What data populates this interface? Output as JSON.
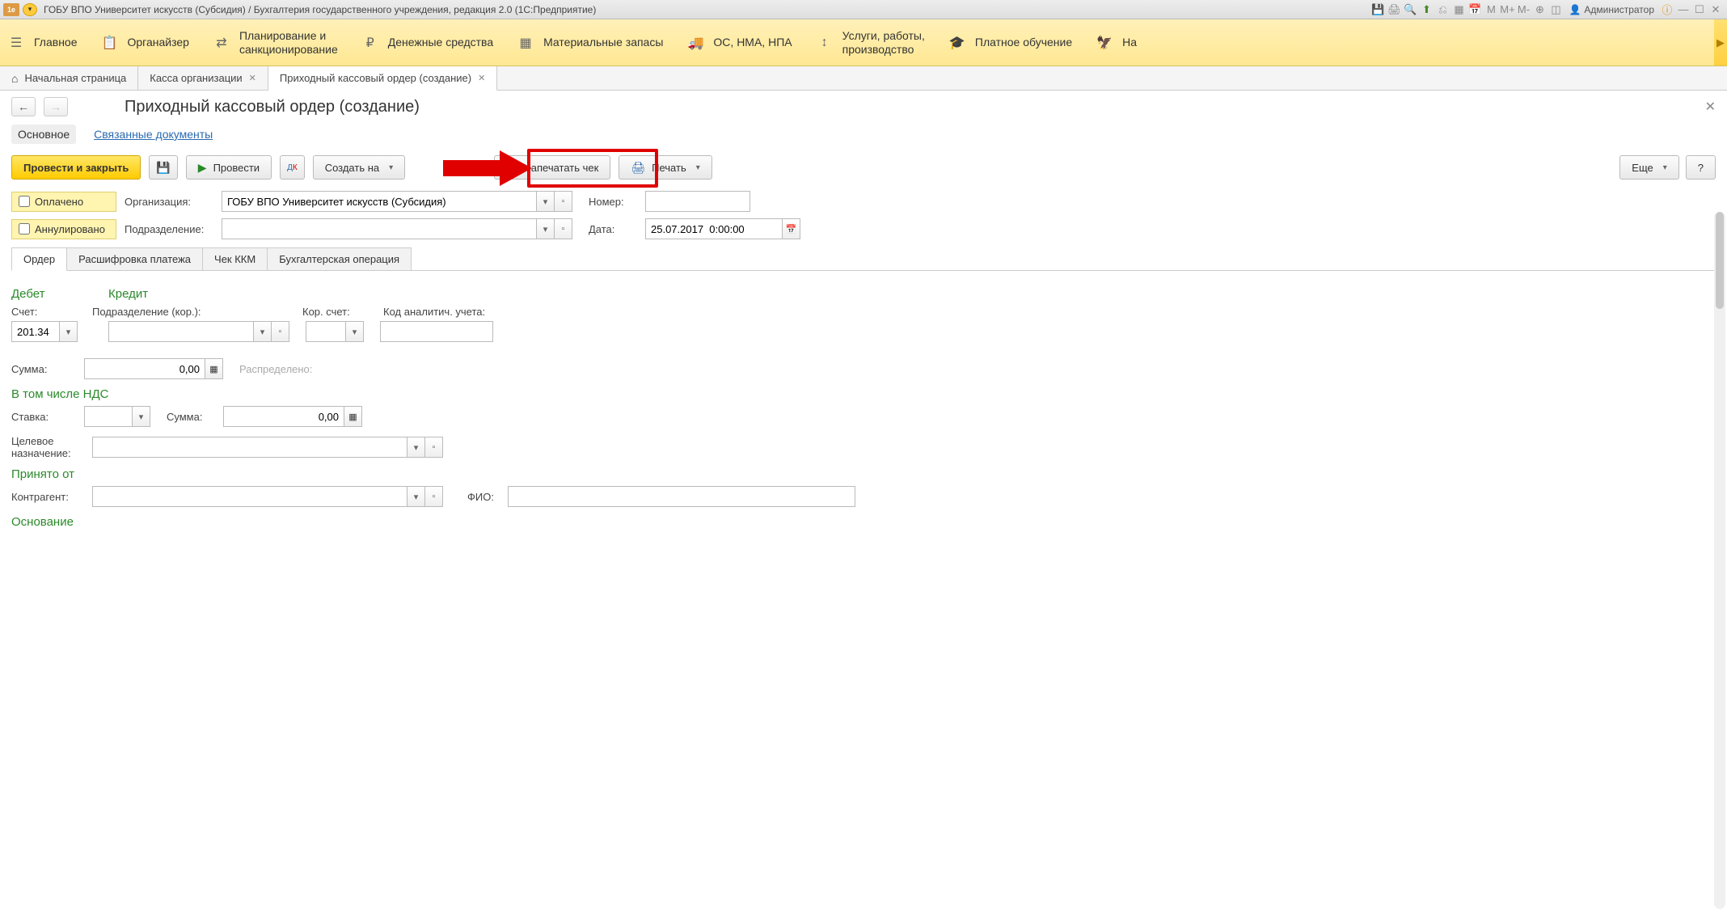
{
  "titlebar": {
    "logo_text": "1e",
    "title": "ГОБУ ВПО Университет искусств (Субсидия) / Бухгалтерия государственного учреждения, редакция 2.0  (1С:Предприятие)",
    "admin": "Администратор",
    "m1": "M",
    "m2": "M+",
    "m3": "M-"
  },
  "mainnav": {
    "items": [
      {
        "icon": "☰",
        "label": "Главное"
      },
      {
        "icon": "📋",
        "label": "Органайзер"
      },
      {
        "icon": "⇄",
        "label": "Планирование и\nсанкционирование"
      },
      {
        "icon": "₽",
        "label": "Денежные средства"
      },
      {
        "icon": "▦",
        "label": "Материальные запасы"
      },
      {
        "icon": "🚚",
        "label": "ОС, НМА, НПА"
      },
      {
        "icon": "↕",
        "label": "Услуги, работы,\nпроизводство"
      },
      {
        "icon": "🎓",
        "label": "Платное обучение"
      },
      {
        "icon": "🦅",
        "label": "На"
      }
    ]
  },
  "tabs": [
    {
      "icon": "⌂",
      "label": "Начальная страница",
      "closable": false
    },
    {
      "label": "Касса организации",
      "closable": true
    },
    {
      "label": "Приходный кассовый ордер (создание)",
      "closable": true,
      "active": true
    }
  ],
  "page": {
    "title": "Приходный кассовый ордер (создание)",
    "subnav": {
      "main": "Основное",
      "link": "Связанные документы"
    }
  },
  "toolbar": {
    "post_close": "Провести и закрыть",
    "post": "Провести",
    "create_based": "Создать на",
    "print_check": "Напечатать чек",
    "print": "Печать",
    "more": "Еще",
    "help": "?"
  },
  "form": {
    "paid_label": "Оплачено",
    "cancelled_label": "Аннулировано",
    "org_label": "Организация:",
    "org_value": "ГОБУ ВПО Университет искусств (Субсидия)",
    "dept_label": "Подразделение:",
    "dept_value": "",
    "num_label": "Номер:",
    "num_value": "",
    "date_label": "Дата:",
    "date_value": "25.07.2017  0:00:00"
  },
  "innertabs": [
    "Ордер",
    "Расшифровка платежа",
    "Чек ККМ",
    "Бухгалтерская операция"
  ],
  "order": {
    "debit_hdr": "Дебет",
    "credit_hdr": "Кредит",
    "acct_label": "Счет:",
    "acct_value": "201.34",
    "dept_cor_label": "Подразделение (кор.):",
    "cor_acct_label": "Кор. счет:",
    "analytic_label": "Код аналитич. учета:",
    "sum_label": "Сумма:",
    "sum_value": "0,00",
    "distributed": "Распределено:",
    "vat_hdr": "В том числе НДС",
    "rate_label": "Ставка:",
    "vat_sum_label": "Сумма:",
    "vat_sum_value": "0,00",
    "purpose_label": "Целевое\nназначение:",
    "received_hdr": "Принято от",
    "counterparty_label": "Контрагент:",
    "fio_label": "ФИО:",
    "reason_hdr": "Основание"
  }
}
